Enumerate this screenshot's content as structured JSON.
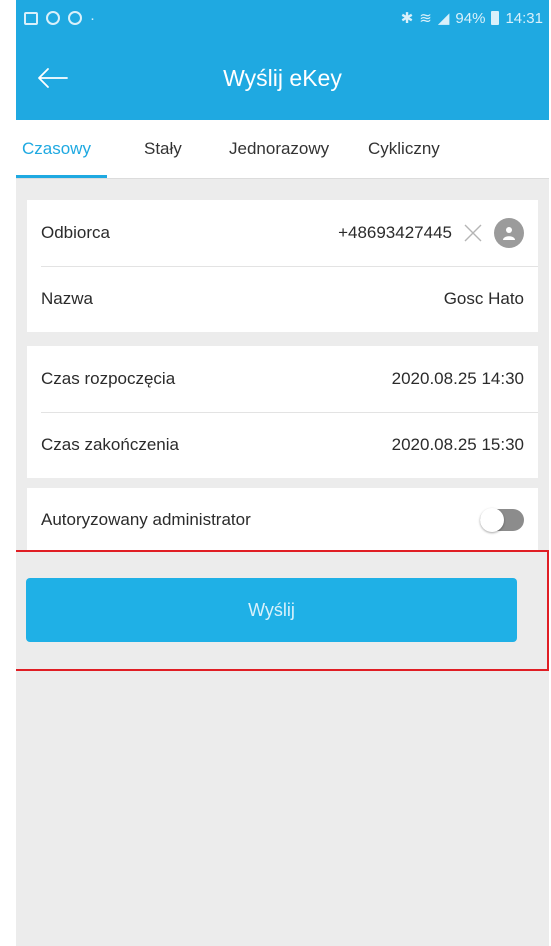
{
  "status_bar": {
    "battery": "94%",
    "time": "14:31"
  },
  "app_bar": {
    "title": "Wyślij eKey"
  },
  "tabs": [
    {
      "label": "Czasowy",
      "active": true
    },
    {
      "label": "Stały",
      "active": false
    },
    {
      "label": "Jednorazowy",
      "active": false
    },
    {
      "label": "Cykliczny",
      "active": false
    }
  ],
  "recipient": {
    "label": "Odbiorca",
    "value": "+48693427445"
  },
  "name": {
    "label": "Nazwa",
    "value": "Gosc Hato"
  },
  "start_time": {
    "label": "Czas rozpoczęcia",
    "value": "2020.08.25 14:30"
  },
  "end_time": {
    "label": "Czas zakończenia",
    "value": "2020.08.25 15:30"
  },
  "admin": {
    "label": "Autoryzowany administrator",
    "enabled": false
  },
  "send_button": {
    "label": "Wyślij"
  },
  "colors": {
    "accent": "#1fa9e1",
    "highlight_border": "#e01e24",
    "background": "#ececec"
  }
}
